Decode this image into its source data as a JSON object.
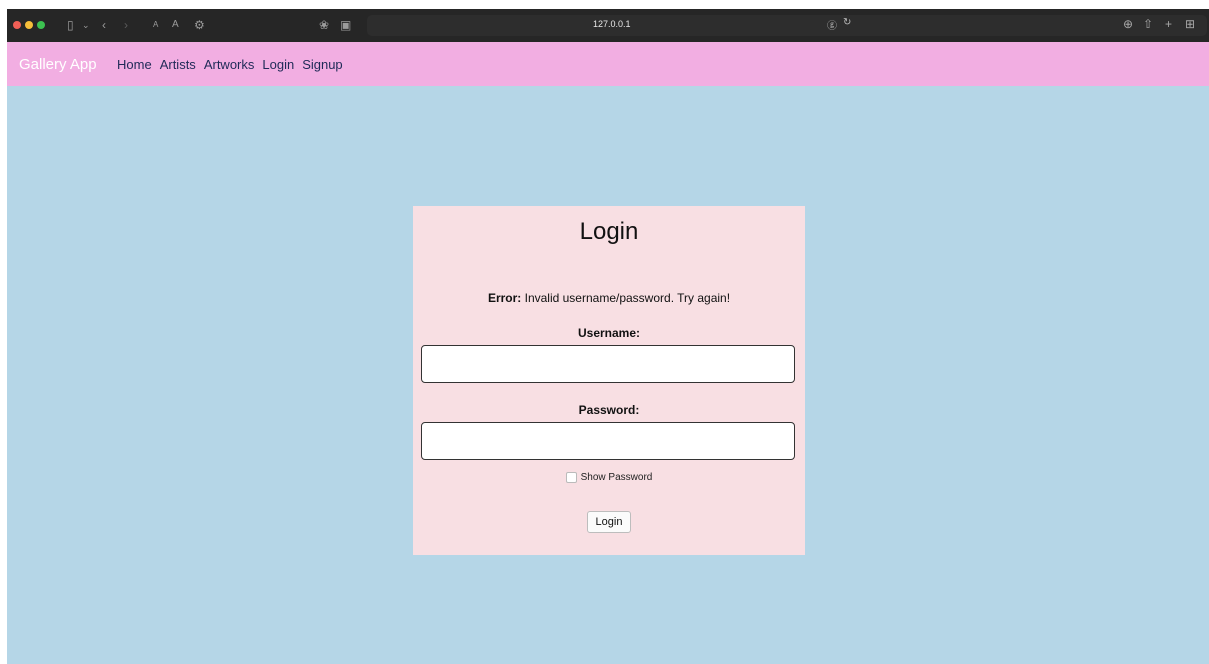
{
  "browser": {
    "url": "127.0.0.1",
    "icons": [
      "sidebar-icon",
      "chevron-down-icon",
      "back-icon",
      "forward-icon",
      "text-smaller-icon",
      "text-larger-icon",
      "settings-icon",
      "extension-icon",
      "reader-icon",
      "translate-icon",
      "reload-icon",
      "download-icon",
      "share-icon",
      "new-tab-icon",
      "tab-overview-icon"
    ]
  },
  "nav": {
    "brand": "Gallery App",
    "links": [
      "Home",
      "Artists",
      "Artworks",
      "Login",
      "Signup"
    ]
  },
  "login": {
    "title": "Login",
    "error_label": "Error:",
    "error_message": " Invalid username/password. Try again!",
    "username_label": "Username:",
    "username_value": "",
    "password_label": "Password:",
    "password_value": "",
    "show_password_label": "Show Password",
    "button_label": "Login"
  },
  "colors": {
    "background": "#b5d6e7",
    "navbar": "#f2aee2",
    "card": "#f8dfe3"
  }
}
